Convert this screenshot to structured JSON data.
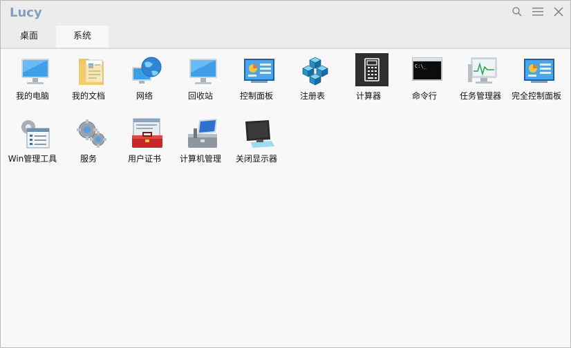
{
  "window": {
    "title": "Lucy"
  },
  "tabs": [
    {
      "label": "桌面",
      "active": false
    },
    {
      "label": "系统",
      "active": true
    }
  ],
  "icons": {
    "search": "search-icon",
    "menu": "menu-icon",
    "close": "close-icon"
  },
  "colors": {
    "title": "#7f9fc7",
    "selected_tile": "#2f2f2f"
  },
  "items_row1": [
    {
      "label": "我的电脑",
      "icon": "computer-icon"
    },
    {
      "label": "我的文档",
      "icon": "documents-icon"
    },
    {
      "label": "网络",
      "icon": "network-globe-icon"
    },
    {
      "label": "回收站",
      "icon": "recycle-bin-icon"
    },
    {
      "label": "控制面板",
      "icon": "control-panel-icon"
    },
    {
      "label": "注册表",
      "icon": "registry-icon"
    },
    {
      "label": "计算器",
      "icon": "calculator-icon",
      "selected": true
    },
    {
      "label": "命令行",
      "icon": "command-prompt-icon"
    },
    {
      "label": "任务管理器",
      "icon": "task-manager-icon"
    },
    {
      "label": "完全控制面板",
      "icon": "control-panel-icon"
    }
  ],
  "items_row2": [
    {
      "label": "Win管理工具",
      "icon": "admin-tools-icon"
    },
    {
      "label": "服务",
      "icon": "services-gears-icon"
    },
    {
      "label": "用户证书",
      "icon": "certificate-toolbox-icon"
    },
    {
      "label": "计算机管理",
      "icon": "computer-management-icon"
    },
    {
      "label": "关闭显示器",
      "icon": "monitor-off-icon"
    }
  ]
}
